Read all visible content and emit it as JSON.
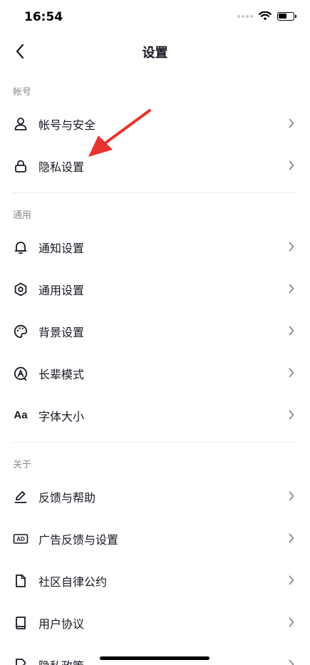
{
  "status_bar": {
    "time": "16:54"
  },
  "nav": {
    "title": "设置"
  },
  "sections": [
    {
      "header": "帐号",
      "items": [
        {
          "label": "帐号与安全",
          "icon": "person-icon"
        },
        {
          "label": "隐私设置",
          "icon": "lock-icon"
        }
      ]
    },
    {
      "header": "通用",
      "items": [
        {
          "label": "通知设置",
          "icon": "bell-icon"
        },
        {
          "label": "通用设置",
          "icon": "gear-icon"
        },
        {
          "label": "背景设置",
          "icon": "palette-icon"
        },
        {
          "label": "长辈模式",
          "icon": "elder-mode-icon"
        },
        {
          "label": "字体大小",
          "icon": "font-size-icon",
          "icon_text": "Aa"
        }
      ]
    },
    {
      "header": "关于",
      "items": [
        {
          "label": "反馈与帮助",
          "icon": "pen-icon"
        },
        {
          "label": "广告反馈与设置",
          "icon": "ad-icon",
          "icon_text": "AD"
        },
        {
          "label": "社区自律公约",
          "icon": "document-icon"
        },
        {
          "label": "用户协议",
          "icon": "book-icon"
        },
        {
          "label": "隐私政策",
          "icon": "privacy-document-icon"
        }
      ]
    }
  ],
  "colors": {
    "text": "#161823",
    "secondary_text": "#8a8b91",
    "chevron": "#8a8b91",
    "divider": "#e8e8ea",
    "annotation": "#e8332e"
  }
}
